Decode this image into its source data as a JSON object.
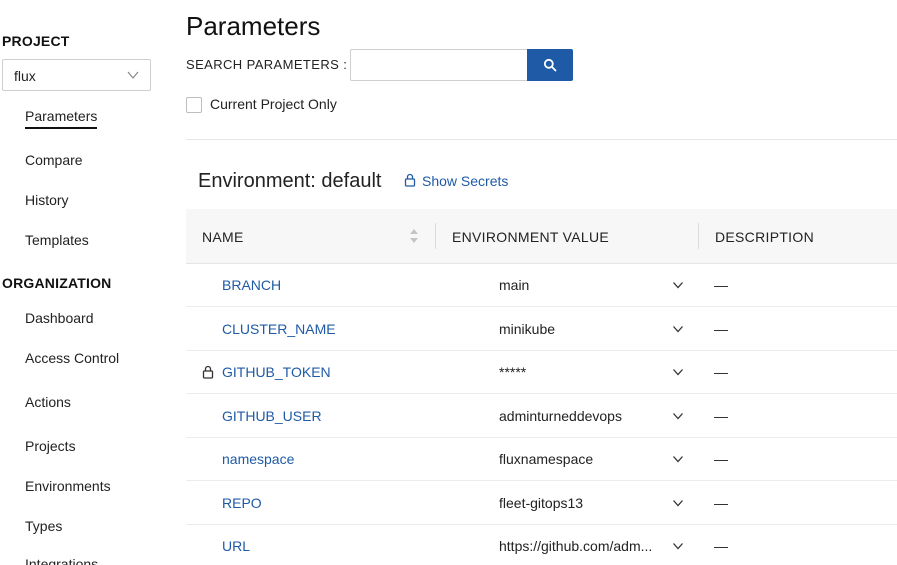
{
  "sidebar": {
    "project_heading": "PROJECT",
    "project_selected": "flux",
    "project_items": [
      {
        "label": "Parameters"
      },
      {
        "label": "Compare"
      },
      {
        "label": "History"
      },
      {
        "label": "Templates"
      }
    ],
    "org_heading": "ORGANIZATION",
    "org_items": [
      {
        "label": "Dashboard"
      },
      {
        "label": "Access Control"
      },
      {
        "label": "Actions"
      },
      {
        "label": "Projects"
      },
      {
        "label": "Environments"
      },
      {
        "label": "Types"
      },
      {
        "label": "Integrations"
      }
    ]
  },
  "main": {
    "title": "Parameters",
    "search": {
      "label": "SEARCH PARAMETERS :",
      "value": "",
      "placeholder": ""
    },
    "current_project_only": {
      "label": "Current Project Only",
      "checked": false
    },
    "environment_title": "Environment: default",
    "show_secrets_label": "Show Secrets",
    "table": {
      "columns": [
        "NAME",
        "ENVIRONMENT VALUE",
        "DESCRIPTION"
      ],
      "rows": [
        {
          "name": "BRANCH",
          "value": "main",
          "description": "—",
          "secret": false
        },
        {
          "name": "CLUSTER_NAME",
          "value": "minikube",
          "description": "—",
          "secret": false
        },
        {
          "name": "GITHUB_TOKEN",
          "value": "*****",
          "description": "—",
          "secret": true
        },
        {
          "name": "GITHUB_USER",
          "value": "adminturneddevops",
          "description": "—",
          "secret": false
        },
        {
          "name": "namespace",
          "value": "fluxnamespace",
          "description": "—",
          "secret": false
        },
        {
          "name": "REPO",
          "value": "fleet-gitops13",
          "description": "—",
          "secret": false
        },
        {
          "name": "URL",
          "value": "https://github.com/adm...",
          "description": "—",
          "secret": false
        }
      ]
    }
  },
  "colors": {
    "accent": "#1f5aa6",
    "header_bg": "#f7f7f7",
    "border": "#e6e6e6"
  },
  "icons": {
    "search_button": "search-icon",
    "secrets": "lock-icon",
    "sort": "sort-icon",
    "row_expand": "chevron-down-icon",
    "select": "chevron-down-icon"
  }
}
